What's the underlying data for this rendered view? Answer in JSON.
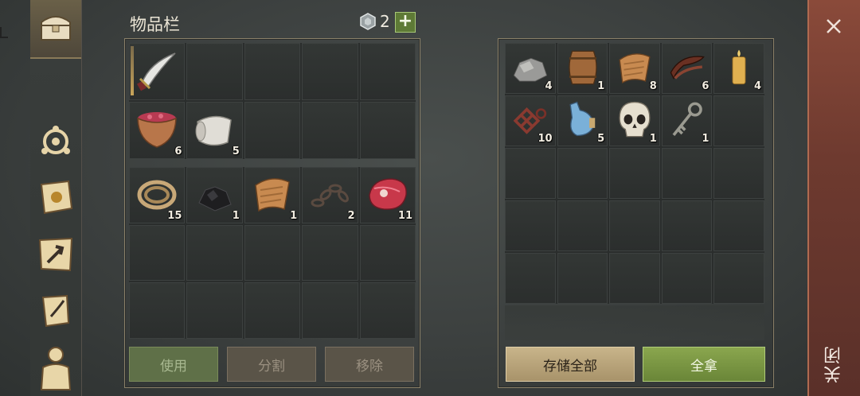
{
  "inventory": {
    "title": "物品栏",
    "gem_count": "2",
    "add_label": "+",
    "equipped": [
      {
        "icon": "scimitar-icon",
        "count": ""
      },
      {
        "icon": "berry-bowl-icon",
        "count": "6"
      },
      {
        "icon": "cloth-roll-icon",
        "count": "5"
      }
    ],
    "items": [
      {
        "icon": "rope-icon",
        "count": "15"
      },
      {
        "icon": "coal-icon",
        "count": "1"
      },
      {
        "icon": "leather-scrap-icon",
        "count": "1"
      },
      {
        "icon": "chain-icon",
        "count": "2"
      },
      {
        "icon": "raw-meat-icon",
        "count": "11"
      }
    ],
    "buttons": {
      "use": "使用",
      "split": "分割",
      "remove": "移除"
    }
  },
  "container": {
    "items": [
      {
        "icon": "stone-icon",
        "count": "4"
      },
      {
        "icon": "barrel-icon",
        "count": "1"
      },
      {
        "icon": "leather-scrap-icon",
        "count": "8"
      },
      {
        "icon": "leather-strap-icon",
        "count": "6"
      },
      {
        "icon": "candle-icon",
        "count": "4"
      },
      {
        "icon": "tangled-wire-icon",
        "count": "10"
      },
      {
        "icon": "potion-bottle-icon",
        "count": "5"
      },
      {
        "icon": "skull-icon",
        "count": "1"
      },
      {
        "icon": "key-icon",
        "count": "1"
      }
    ],
    "buttons": {
      "store_all": "存储全部",
      "take_all": "全拿"
    }
  },
  "close": {
    "label": "关闭",
    "icon": "close-icon"
  },
  "nav": [
    "chest-icon",
    "compass-icon",
    "sun-book-icon",
    "map-icon",
    "scroll-icon",
    "character-icon"
  ],
  "colors": {
    "accent_green": "#6f8f3f",
    "button_tan": "#b9a478",
    "close_red": "#7a4233"
  }
}
